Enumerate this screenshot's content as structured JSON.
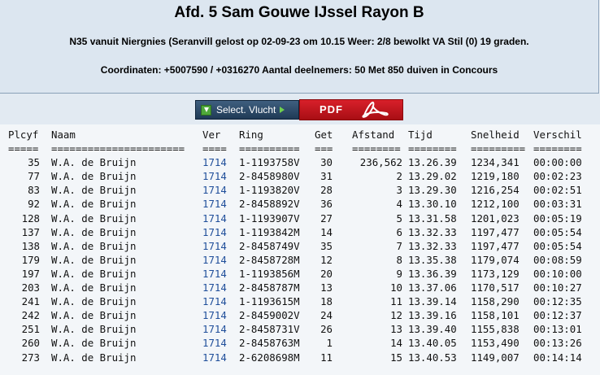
{
  "header": {
    "title": "Afd. 5 Sam Gouwe IJssel Rayon B",
    "subtitle": "N35 vanuit Niergnies (Seranvill gelost op 02-09-23 om 10.15 Weer: 2/8 bewolkt VA Stil (0) 19 graden.",
    "coordinates": "Coordinaten: +5007590 / +0316270 Aantal deelnemers: 50 Met 850 duiven in Concours"
  },
  "toolbar": {
    "select_label": "Select. Vlucht",
    "pdf_label": "PDF"
  },
  "table": {
    "columns": {
      "plcyf": "Plcyf",
      "naam": "Naam",
      "ver": "Ver",
      "ring": "Ring",
      "get": "Get",
      "afstand": "Afstand",
      "tijd": "Tijd",
      "snelheid": "Snelheid",
      "verschil": "Verschil"
    },
    "separators": {
      "plcyf": "=====",
      "naam": "======================",
      "ver": "====",
      "ring": "==========",
      "get": "===",
      "afstand": "========",
      "tijd": "========",
      "snelheid": "=========",
      "verschil": "========"
    },
    "rows": [
      {
        "plcyf": "35",
        "naam": "W.A. de Bruijn",
        "ver": "1714",
        "ring": "1-1193758V",
        "get": "30",
        "afstand": "236,562",
        "tijd": "13.26.39",
        "snelheid": "1234,341",
        "verschil": "00:00:00"
      },
      {
        "plcyf": "77",
        "naam": "W.A. de Bruijn",
        "ver": "1714",
        "ring": "2-8458980V",
        "get": "31",
        "afstand": "2",
        "tijd": "13.29.02",
        "snelheid": "1219,180",
        "verschil": "00:02:23"
      },
      {
        "plcyf": "83",
        "naam": "W.A. de Bruijn",
        "ver": "1714",
        "ring": "1-1193820V",
        "get": "28",
        "afstand": "3",
        "tijd": "13.29.30",
        "snelheid": "1216,254",
        "verschil": "00:02:51"
      },
      {
        "plcyf": "92",
        "naam": "W.A. de Bruijn",
        "ver": "1714",
        "ring": "2-8458892V",
        "get": "36",
        "afstand": "4",
        "tijd": "13.30.10",
        "snelheid": "1212,100",
        "verschil": "00:03:31"
      },
      {
        "plcyf": "128",
        "naam": "W.A. de Bruijn",
        "ver": "1714",
        "ring": "1-1193907V",
        "get": "27",
        "afstand": "5",
        "tijd": "13.31.58",
        "snelheid": "1201,023",
        "verschil": "00:05:19"
      },
      {
        "plcyf": "137",
        "naam": "W.A. de Bruijn",
        "ver": "1714",
        "ring": "1-1193842M",
        "get": "14",
        "afstand": "6",
        "tijd": "13.32.33",
        "snelheid": "1197,477",
        "verschil": "00:05:54"
      },
      {
        "plcyf": "138",
        "naam": "W.A. de Bruijn",
        "ver": "1714",
        "ring": "2-8458749V",
        "get": "35",
        "afstand": "7",
        "tijd": "13.32.33",
        "snelheid": "1197,477",
        "verschil": "00:05:54"
      },
      {
        "plcyf": "179",
        "naam": "W.A. de Bruijn",
        "ver": "1714",
        "ring": "2-8458728M",
        "get": "12",
        "afstand": "8",
        "tijd": "13.35.38",
        "snelheid": "1179,074",
        "verschil": "00:08:59"
      },
      {
        "plcyf": "197",
        "naam": "W.A. de Bruijn",
        "ver": "1714",
        "ring": "1-1193856M",
        "get": "20",
        "afstand": "9",
        "tijd": "13.36.39",
        "snelheid": "1173,129",
        "verschil": "00:10:00"
      },
      {
        "plcyf": "203",
        "naam": "W.A. de Bruijn",
        "ver": "1714",
        "ring": "2-8458787M",
        "get": "13",
        "afstand": "10",
        "tijd": "13.37.06",
        "snelheid": "1170,517",
        "verschil": "00:10:27"
      },
      {
        "plcyf": "241",
        "naam": "W.A. de Bruijn",
        "ver": "1714",
        "ring": "1-1193615M",
        "get": "18",
        "afstand": "11",
        "tijd": "13.39.14",
        "snelheid": "1158,290",
        "verschil": "00:12:35"
      },
      {
        "plcyf": "242",
        "naam": "W.A. de Bruijn",
        "ver": "1714",
        "ring": "2-8459002V",
        "get": "24",
        "afstand": "12",
        "tijd": "13.39.16",
        "snelheid": "1158,101",
        "verschil": "00:12:37"
      },
      {
        "plcyf": "251",
        "naam": "W.A. de Bruijn",
        "ver": "1714",
        "ring": "2-8458731V",
        "get": "26",
        "afstand": "13",
        "tijd": "13.39.40",
        "snelheid": "1155,838",
        "verschil": "00:13:01"
      },
      {
        "plcyf": "260",
        "naam": "W.A. de Bruijn",
        "ver": "1714",
        "ring": "2-8458763M",
        "get": "1",
        "afstand": "14",
        "tijd": "13.40.05",
        "snelheid": "1153,490",
        "verschil": "00:13:26"
      },
      {
        "plcyf": "273",
        "naam": "W.A. de Bruijn",
        "ver": "1714",
        "ring": "2-6208698M",
        "get": "11",
        "afstand": "15",
        "tijd": "13.40.53",
        "snelheid": "1149,007",
        "verschil": "00:14:14"
      }
    ]
  },
  "colors": {
    "header_bg": "#dce6f0",
    "page_bg": "#f3f6f9",
    "ver_link": "#1f4e9a",
    "pdf_red": "#c8141c",
    "select_bg": "#2c4a68"
  },
  "icons": {
    "select_icon": "download-icon",
    "select_arrow": "arrow-right-icon",
    "pdf_icon": "acrobat-icon"
  }
}
